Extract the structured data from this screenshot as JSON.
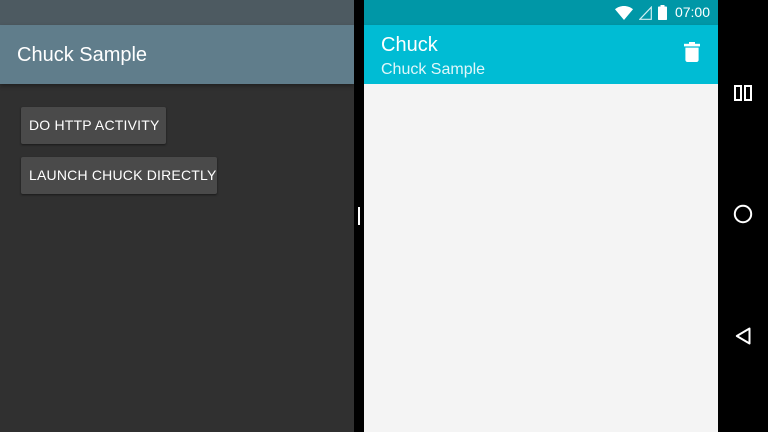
{
  "left_app": {
    "title": "Chuck Sample",
    "buttons": {
      "http_activity": "DO HTTP ACTIVITY",
      "launch_chuck": "LAUNCH CHUCK DIRECTLY"
    }
  },
  "right_app": {
    "title": "Chuck",
    "subtitle": "Chuck Sample",
    "status_bar": {
      "time": "07:00",
      "icons": [
        "wifi-icon",
        "cell-signal-icon",
        "battery-icon"
      ]
    },
    "actions": [
      "delete-icon"
    ]
  },
  "nav_bar": {
    "buttons": [
      "recents-icon",
      "home-icon",
      "back-icon"
    ]
  },
  "colors": {
    "left_appbar": "#607d8b",
    "left_statusbar": "#4d5a61",
    "left_background": "#303030",
    "right_appbar": "#00bcd4",
    "right_statusbar": "#0097a7",
    "right_background": "#f4f4f4"
  }
}
